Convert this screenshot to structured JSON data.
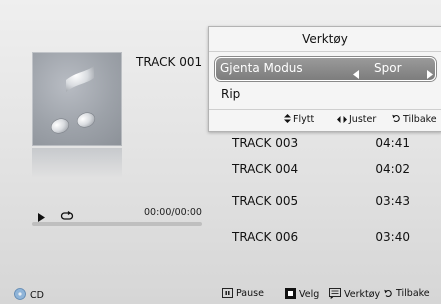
{
  "now_playing": {
    "track_title": "TRACK 001",
    "time": "00:00/00:00",
    "progress": 0
  },
  "tracks": [
    {
      "name": "TRACK 003",
      "duration": "04:41"
    },
    {
      "name": "TRACK 004",
      "duration": "04:02"
    },
    {
      "name": "TRACK 005",
      "duration": "03:43"
    },
    {
      "name": "TRACK 006",
      "duration": "03:40"
    }
  ],
  "tools_menu": {
    "title": "Verktøy",
    "repeat_mode": {
      "label": "Gjenta Modus",
      "value": "Spor"
    },
    "rip_label": "Rip",
    "hints": {
      "move": "Flytt",
      "adjust": "Juster",
      "back": "Tilbake"
    }
  },
  "bottom_bar": {
    "source": "CD",
    "pause": "Pause",
    "select": "Velg",
    "tools": "Verktøy",
    "back": "Tilbake"
  },
  "icons": {
    "album": "music-note-icon",
    "play": "play-icon",
    "repeat": "repeat-icon",
    "source": "disc-icon"
  },
  "colors": {
    "highlight": "#8a8a8a",
    "panel": "#f5f5f5",
    "background": "#e4e4e4"
  }
}
